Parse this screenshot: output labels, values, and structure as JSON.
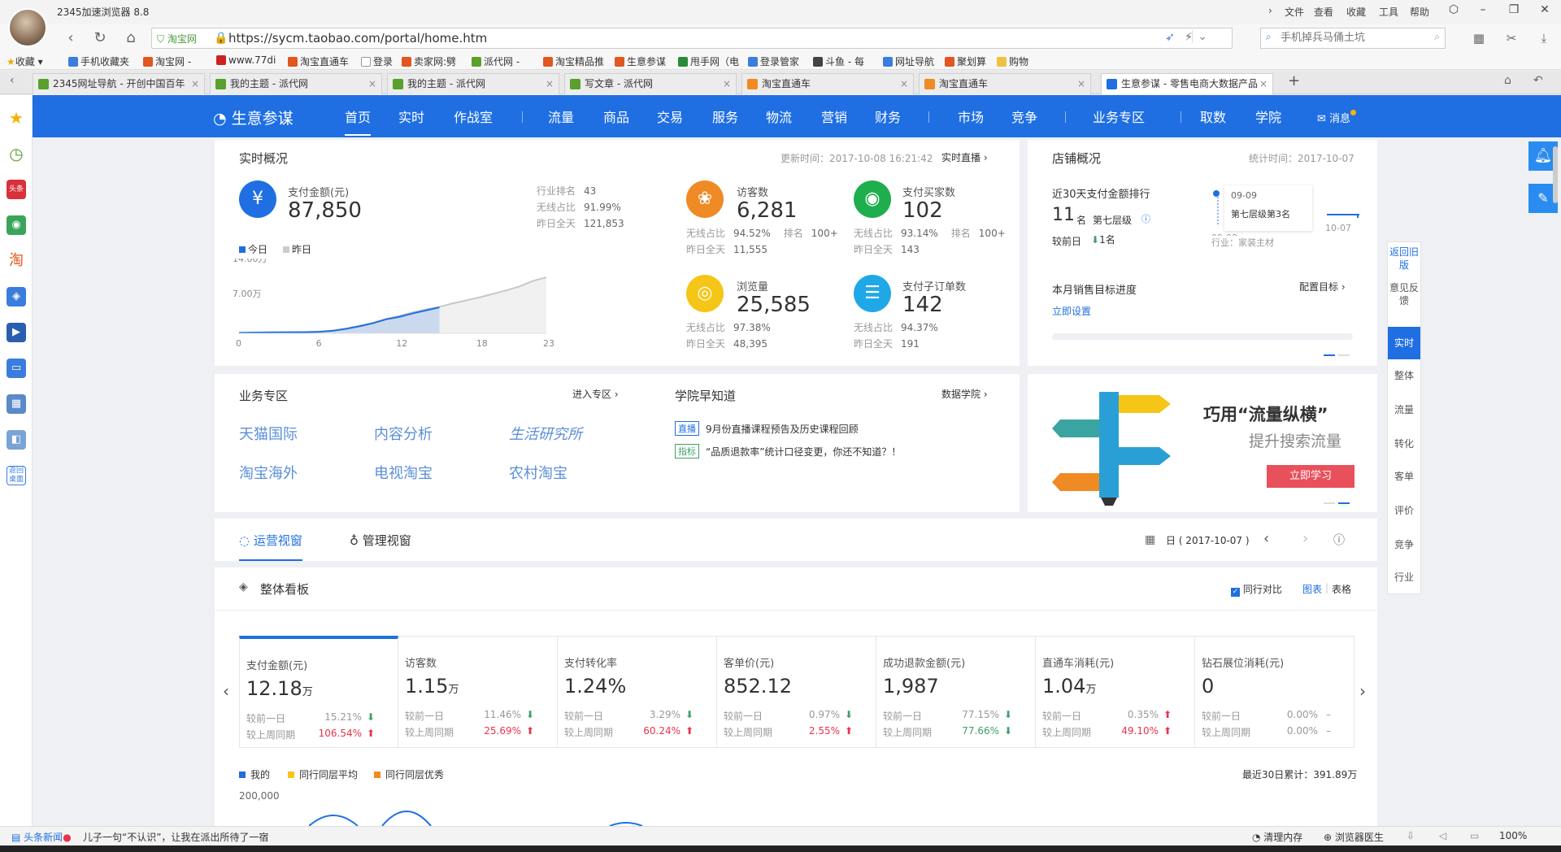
{
  "browser": {
    "title": "2345加速浏览器 8.8",
    "menu": [
      "文件",
      "查看",
      "收藏",
      "工具",
      "帮助"
    ],
    "url": "https://sycm.taobao.com/portal/home.htm",
    "site_badge": "淘宝网",
    "search_placeholder": "手机掉兵马俑土坑",
    "bookmarks": [
      "收藏",
      "手机收藏夹",
      "淘宝网 -",
      "www.77di",
      "淘宝直通车",
      "登录",
      "卖家网:劈",
      "派代网 -",
      "淘宝精品推",
      "生意参谋",
      "甩手网（电",
      "登录管家",
      "斗鱼 - 每",
      "网址导航",
      "聚划算",
      "购物"
    ],
    "tabs": [
      "2345网址导航 - 开创中国百年",
      "我的主题 - 派代网",
      "我的主题 - 派代网",
      "写文章 - 派代网",
      "淘宝直通车",
      "淘宝直通车",
      "生意参谋 - 零售电商大数据产品"
    ],
    "status_left": "头条新闻",
    "status_news": "儿子一句“不认识”，让我在派出所待了一宿",
    "status_right": [
      "清理内存",
      "浏览器医生",
      "100%"
    ]
  },
  "nav": {
    "logo": "生意参谋",
    "items": [
      "首页",
      "实时",
      "作战室",
      "流量",
      "商品",
      "交易",
      "服务",
      "物流",
      "营销",
      "财务",
      "市场",
      "竞争",
      "业务专区",
      "取数",
      "学院",
      "消息"
    ]
  },
  "right_rail": [
    "返回旧版",
    "意见反馈",
    "实时",
    "整体",
    "流量",
    "转化",
    "客单",
    "评价",
    "竞争",
    "行业"
  ],
  "realtime": {
    "title": "实时概况",
    "updated": "更新时间：2017-10-08 16:21:42",
    "live_link": "实时直播",
    "pay_amount_label": "支付金额(元)",
    "pay_amount": "87,850",
    "industry_rank_label": "行业排名",
    "industry_rank": "43",
    "wireless_ratio_label": "无线占比",
    "wireless_ratio": "91.99%",
    "yesterday_label": "昨日全天",
    "yesterday": "121,853",
    "legend_today": "今日",
    "legend_yesterday": "昨日",
    "visitors_label": "访客数",
    "visitors": "6,281",
    "visitors_wireless": "94.52%",
    "visitors_rank_label": "排名",
    "visitors_rank": "100+",
    "visitors_yesterday": "11,555",
    "buyers_label": "支付买家数",
    "buyers": "102",
    "buyers_wireless": "93.14%",
    "buyers_rank": "100+",
    "buyers_yesterday": "143",
    "pv_label": "浏览量",
    "pv": "25,585",
    "pv_wireless": "97.38%",
    "pv_yesterday": "48,395",
    "orders_label": "支付子订单数",
    "orders": "142",
    "orders_wireless": "94.37%",
    "orders_yesterday": "191"
  },
  "chart_data": {
    "type": "area",
    "x_ticks": [
      "0",
      "6",
      "12",
      "18",
      "23"
    ],
    "y_ticks": [
      "14.00万",
      "7.00万"
    ],
    "ylim": [
      0,
      140000
    ],
    "x": [
      0,
      1,
      2,
      3,
      4,
      5,
      6,
      7,
      8,
      9,
      10,
      11,
      12,
      13,
      14,
      15,
      16,
      17,
      18,
      19,
      20,
      21,
      22,
      23
    ],
    "series": [
      {
        "name": "今日",
        "values": [
          1000,
          1500,
          1800,
          2000,
          2200,
          2400,
          3000,
          5000,
          9000,
          14000,
          20000,
          28000,
          33000,
          40000,
          46000,
          52000,
          null,
          null,
          null,
          null,
          null,
          null,
          null,
          null
        ]
      },
      {
        "name": "昨日",
        "values": [
          1200,
          1600,
          1900,
          2100,
          2300,
          2500,
          3200,
          5500,
          9500,
          15000,
          21000,
          29000,
          35000,
          42000,
          48000,
          53000,
          60000,
          66000,
          72000,
          79000,
          86000,
          94000,
          105000,
          112000
        ]
      }
    ]
  },
  "shop": {
    "title": "店铺概况",
    "stat_time": "统计时间：2017-10-07",
    "rank_label": "近30天支付金额排行",
    "rank": "11",
    "rank_unit": "名",
    "level": "第七层级",
    "compare_label": "较前日",
    "compare_value": "1名",
    "tooltip_date": "09-09",
    "tooltip_text": "第七层级第3名",
    "axis_start": "09-08",
    "axis_end": "10-07",
    "industry": "行业：家装主材",
    "target_label": "本月销售目标进度",
    "target_link": "配置目标",
    "set_now": "立即设置"
  },
  "business": {
    "title": "业务专区",
    "enter": "进入专区",
    "zones": [
      "天猫国际",
      "内容分析",
      "生活研究所",
      "淘宝海外",
      "电视淘宝",
      "农村淘宝"
    ]
  },
  "academy": {
    "title": "学院早知道",
    "link": "数据学院",
    "items": [
      {
        "tag": "直播",
        "text": "9月份直播课程预告及历史课程回顾"
      },
      {
        "tag": "指标",
        "text": "“品质退款率”统计口径变更，你还不知道？！"
      }
    ]
  },
  "banner": {
    "title": "巧用“流量纵横”",
    "subtitle": "提升搜索流量",
    "button": "立即学习"
  },
  "views": {
    "tab1": "运营视窗",
    "tab2": "管理视窗",
    "date": "日 ( 2017-10-07 )"
  },
  "board": {
    "title": "整体看板",
    "compare": "同行对比",
    "view_chart": "图表",
    "view_table": "表格",
    "metrics": [
      {
        "label": "支付金额(元)",
        "value": "12.18",
        "unit": "万",
        "d1": "15.21%",
        "d1dir": "down",
        "w1": "106.54%",
        "w1dir": "up"
      },
      {
        "label": "访客数",
        "value": "1.15",
        "unit": "万",
        "d1": "11.46%",
        "d1dir": "down",
        "w1": "25.69%",
        "w1dir": "up"
      },
      {
        "label": "支付转化率",
        "value": "1.24%",
        "unit": "",
        "d1": "3.29%",
        "d1dir": "down",
        "w1": "60.24%",
        "w1dir": "up"
      },
      {
        "label": "客单价(元)",
        "value": "852.12",
        "unit": "",
        "d1": "0.97%",
        "d1dir": "down",
        "w1": "2.55%",
        "w1dir": "up"
      },
      {
        "label": "成功退款金额(元)",
        "value": "1,987",
        "unit": "",
        "d1": "77.15%",
        "d1dir": "down",
        "w1": "77.66%",
        "w1dir": "down"
      },
      {
        "label": "直通车消耗(元)",
        "value": "1.04",
        "unit": "万",
        "d1": "0.35%",
        "d1dir": "up",
        "w1": "49.10%",
        "w1dir": "up"
      },
      {
        "label": "钻石展位消耗(元)",
        "value": "0",
        "unit": "",
        "d1": "0.00%",
        "d1dir": "none",
        "w1": "0.00%",
        "w1dir": "none"
      }
    ],
    "row1_label": "较前一日",
    "row2_label": "较上周同期",
    "legend": [
      "我的",
      "同行同层平均",
      "同行同层优秀"
    ],
    "total": "最近30日累计：391.89万",
    "y_top": "200,000"
  }
}
